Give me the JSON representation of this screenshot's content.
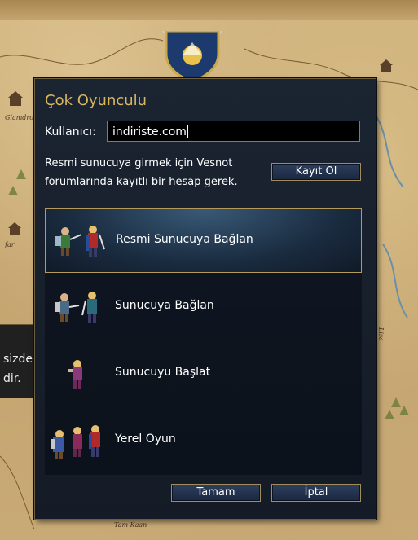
{
  "dialog": {
    "title": "Çok Oyunculu",
    "user_label": "Kullanıcı:",
    "user_value": "indiriste.com",
    "info_line1": "Resmi sunucuya girmek için Vesnot",
    "info_line2": "forumlarında kayıtlı bir hesap gerek.",
    "register_label": "Kayıt Ol",
    "ok_label": "Tamam",
    "cancel_label": "İptal"
  },
  "options": [
    {
      "label": "Resmi Sunucuya Bağlan",
      "icon": "two-warriors-attack-icon",
      "selected": true
    },
    {
      "label": "Sunucuya Bağlan",
      "icon": "two-warriors-icon",
      "selected": false
    },
    {
      "label": "Sunucuyu Başlat",
      "icon": "single-warrior-icon",
      "selected": false
    },
    {
      "label": "Yerel Oyun",
      "icon": "three-warriors-icon",
      "selected": false
    }
  ],
  "background": {
    "map_labels": [
      "Glamdrol",
      "far",
      "Lisa",
      "Tam Kaan"
    ],
    "side_text_1": "sizde",
    "side_text_2": "dir."
  },
  "colors": {
    "title": "#d8b760",
    "dialog_bg": "#141b26",
    "border": "#a08c5c"
  }
}
